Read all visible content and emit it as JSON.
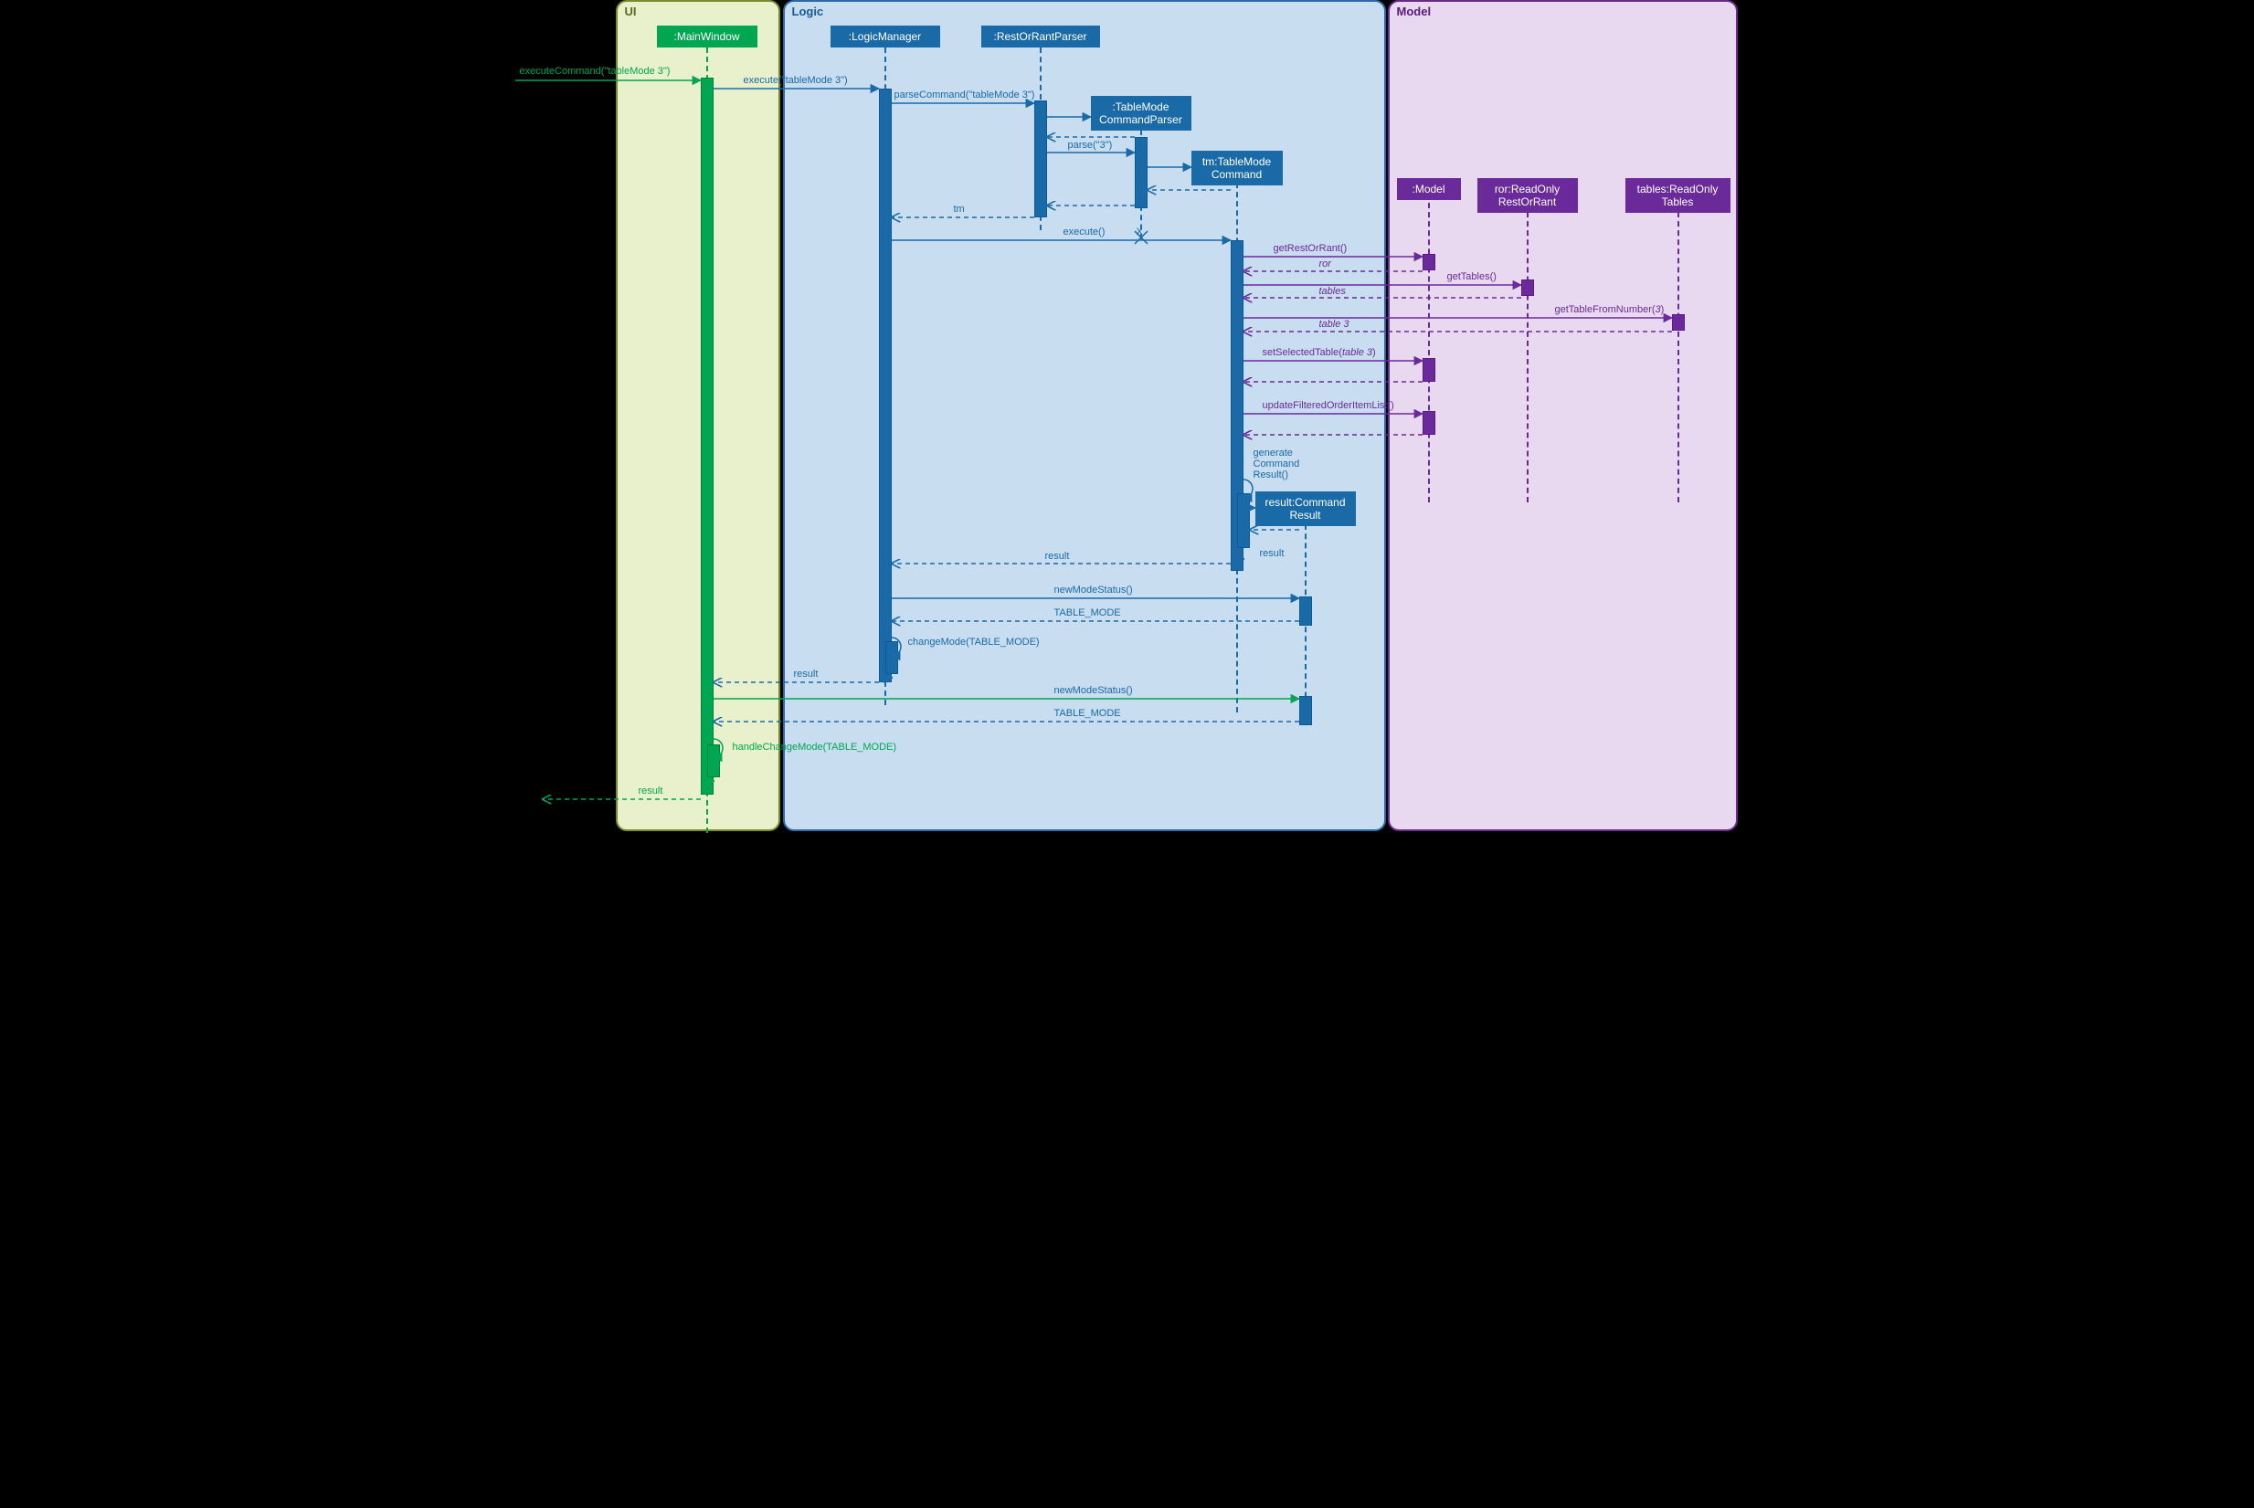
{
  "frames": {
    "ui": "UI",
    "logic": "Logic",
    "model": "Model"
  },
  "participants": {
    "main_window": ":MainWindow",
    "logic_manager": ":LogicManager",
    "ror_parser": ":RestOrRantParser",
    "tm_parser": ":TableMode\nCommandParser",
    "tm_cmd": "tm:TableMode\nCommand",
    "result_obj": "result:Command\nResult",
    "model": ":Model",
    "ror": "ror:ReadOnly\nRestOrRant",
    "tables": "tables:ReadOnly\nTables"
  },
  "messages": {
    "m1": "executeCommand(\"tableMode 3\")",
    "m2": "execute(\"tableMode 3\")",
    "m3": "parseCommand(\"tableMode 3\")",
    "m4": "parse(\"3\")",
    "m5": "tm",
    "m6": "execute()",
    "m7": "getRestOrRant()",
    "m8": "ror",
    "m9": "getTables()",
    "m10": "tables",
    "m11": "getTableFromNumber(3)",
    "m12": "table 3",
    "m13": "setSelectedTable(table 3)",
    "m14": "updateFilteredOrderItemList()",
    "m15": "generate\nCommand\nResult()",
    "m16": "result",
    "m17": "result",
    "m18": "newModeStatus()",
    "m19": "TABLE_MODE",
    "m20": "changeMode(TABLE_MODE)",
    "m21": "result",
    "m22": "newModeStatus()",
    "m23": "TABLE_MODE",
    "m24": "handleChangeMode(TABLE_MODE)",
    "m25": "result"
  }
}
